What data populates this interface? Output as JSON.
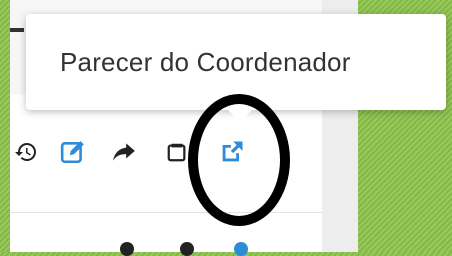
{
  "tooltip": {
    "text": "Parecer do Coordenador"
  },
  "toolbar": {
    "icons": [
      {
        "name": "history-icon",
        "color": "#222222"
      },
      {
        "name": "edit-icon",
        "color": "#2e8bd8"
      },
      {
        "name": "forward-icon",
        "color": "#222222"
      },
      {
        "name": "archive-icon",
        "color": "#222222"
      },
      {
        "name": "external-link-icon",
        "color": "#2e8bd8"
      }
    ]
  },
  "colors": {
    "background_green": "#8bc34a",
    "accent_blue": "#2e8bd8",
    "annotation_black": "#000000"
  }
}
